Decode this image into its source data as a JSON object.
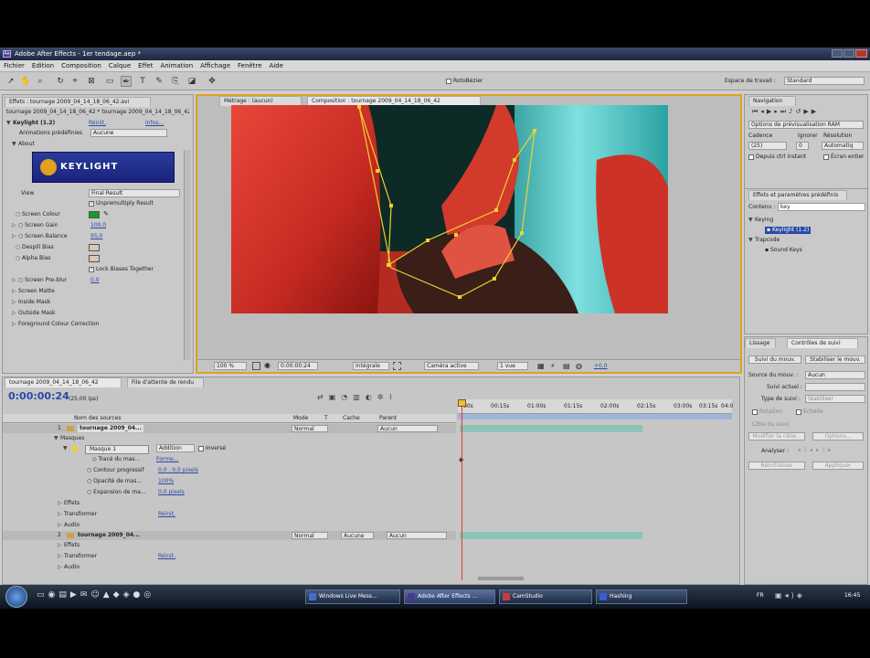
{
  "window": {
    "title": "Adobe After Effects - 1er tendage.aep *"
  },
  "menu": [
    "Fichier",
    "Edition",
    "Composition",
    "Calque",
    "Effet",
    "Animation",
    "Affichage",
    "Fenêtre",
    "Aide"
  ],
  "toolbar": {
    "roto_label": "RotoBézier",
    "workspace_label": "Espace de travail :",
    "workspace_value": "Standard"
  },
  "effects_panel": {
    "tab": "Effets : tournage 2009_04_14_18_06_42.avi",
    "subtitle": "tournage 2009_04_14_18_06_42 * tournage 2009_04_14_18_06_42...",
    "effect_name": "Keylight (1.2)",
    "reset": "Réinit.",
    "about_link": "Infos...",
    "presets_label": "Animations prédéfinies",
    "presets_value": "Aucune",
    "about": "About",
    "logo_text": "KEYLIGHT",
    "params": [
      {
        "label": "View",
        "value": "Final Result",
        "type": "select"
      },
      {
        "label": "",
        "value": "Unpremultiply Result",
        "type": "check"
      },
      {
        "label": "Screen Colour",
        "value": "",
        "type": "color"
      },
      {
        "label": "Screen Gain",
        "value": "100,0",
        "type": "num"
      },
      {
        "label": "Screen Balance",
        "value": "95,0",
        "type": "num"
      },
      {
        "label": "Despill Bias",
        "value": "",
        "type": "color"
      },
      {
        "label": "Alpha Bias",
        "value": "",
        "type": "color"
      },
      {
        "label": "",
        "value": "Lock Biases Together",
        "type": "check"
      },
      {
        "label": "Screen Pre-blur",
        "value": "0,0",
        "type": "num"
      },
      {
        "label": "Screen Matte",
        "value": "",
        "type": "group"
      },
      {
        "label": "Inside Mask",
        "value": "",
        "type": "group"
      },
      {
        "label": "Outside Mask",
        "value": "",
        "type": "group"
      },
      {
        "label": "Foreground Colour Correction",
        "value": "",
        "type": "group"
      }
    ]
  },
  "comp_panel": {
    "tab_footage": "Métrage : (aucun)",
    "tab_comp": "Composition : tournage 2009_04_14_18_06_42",
    "zoom": "100 %",
    "time": "0:00:00:24",
    "resolution": "Intégrale",
    "camera": "Caméra active",
    "views": "1 vue",
    "offset": "+0,0"
  },
  "nav_panel": {
    "tab": "Navigation",
    "options_label": "Options de prévisualisation RAM",
    "cadence_label": "Cadence",
    "skip_label": "Ignorer",
    "resolution_label": "Résolution",
    "cadence_value": "(25)",
    "skip_value": "0",
    "resolution_value": "Automatiq",
    "current_time_check": "Depuis ctrl instant",
    "fullscreen_check": "Écran entier"
  },
  "effects_presets": {
    "tab": "Effets et paramètres prédéfinis",
    "search_label": "Contenu :",
    "search_value": "key",
    "tree": [
      {
        "label": "Keying",
        "depth": 0
      },
      {
        "label": "Keylight (1.2)",
        "depth": 1,
        "selected": true
      },
      {
        "label": "Trapcode",
        "depth": 0
      },
      {
        "label": "Sound Keys",
        "depth": 1
      }
    ]
  },
  "tracker_panel": {
    "tab_left": "Lissage",
    "tab_right": "Contrôles de suivi",
    "track_motion": "Suivi du mouv.",
    "stabilize": "Stabiliser le mouv.",
    "source_label": "Source du mouv. :",
    "source_value": "Aucun",
    "current_track": "Suivi actuel :",
    "track_type": "Type de suivi :",
    "track_type_value": "Stabiliser",
    "rotation": "Rotation",
    "scale": "Échelle",
    "target_label": "Cible du suivi",
    "edit_target": "Modifier la cible...",
    "options": "Options...",
    "analyze": "Analyser :",
    "reset": "Réinitialiser",
    "apply": "Appliquer"
  },
  "timeline": {
    "tab": "tournage 2009_04_14_18_06_42",
    "tab2": "File d'attente de rendu",
    "timecode": "0:00:00:24",
    "fps": "(25,00 ips)",
    "col_source": "Nom des sources",
    "col_mode": "Mode",
    "col_trkmat": "T",
    "col_cache": "Cache",
    "col_parent": "Parent",
    "ruler": [
      "00s",
      "00:15s",
      "01:00s",
      "01:15s",
      "02:00s",
      "02:15s",
      "03:00s",
      "03:15s",
      "04:0"
    ],
    "layers": [
      {
        "num": "1",
        "name": "tournage 2009_04...",
        "mode": "Normal",
        "parent": "Aucun"
      },
      {
        "num": "2",
        "name": "tournage 2009_04...",
        "mode": "Normal",
        "trkmat": "Aucune",
        "parent": "Aucun"
      }
    ],
    "rows": {
      "masks": "Masques",
      "mask1": "Masque 1",
      "mask_mode": "Addition",
      "inverted": "Inversé",
      "mask_path": "Tracé du mas...",
      "mask_path_value": "Forme...",
      "feather_label": "Contour progressif",
      "feather_value": "0,0 , 0,0 pixels",
      "opacity_label": "Opacité de mas...",
      "opacity_value": "100%",
      "expansion_label": "Expansion de ma...",
      "expansion_value": "0,0 pixels",
      "effects": "Effets",
      "transform": "Transformer",
      "transform_reset": "Réinit.",
      "audio": "Audio"
    }
  },
  "taskbar": {
    "buttons": [
      "Windows Live Mess...",
      "Adobe After Effects ...",
      "CamStudio",
      "Hashing"
    ],
    "lang": "FR",
    "clock": "16:45"
  },
  "colors": {
    "accent": "#e0a020",
    "selection": "#2a4aa8",
    "mask_path": "#f0d030",
    "layer_bar": "#8ec4b8"
  }
}
